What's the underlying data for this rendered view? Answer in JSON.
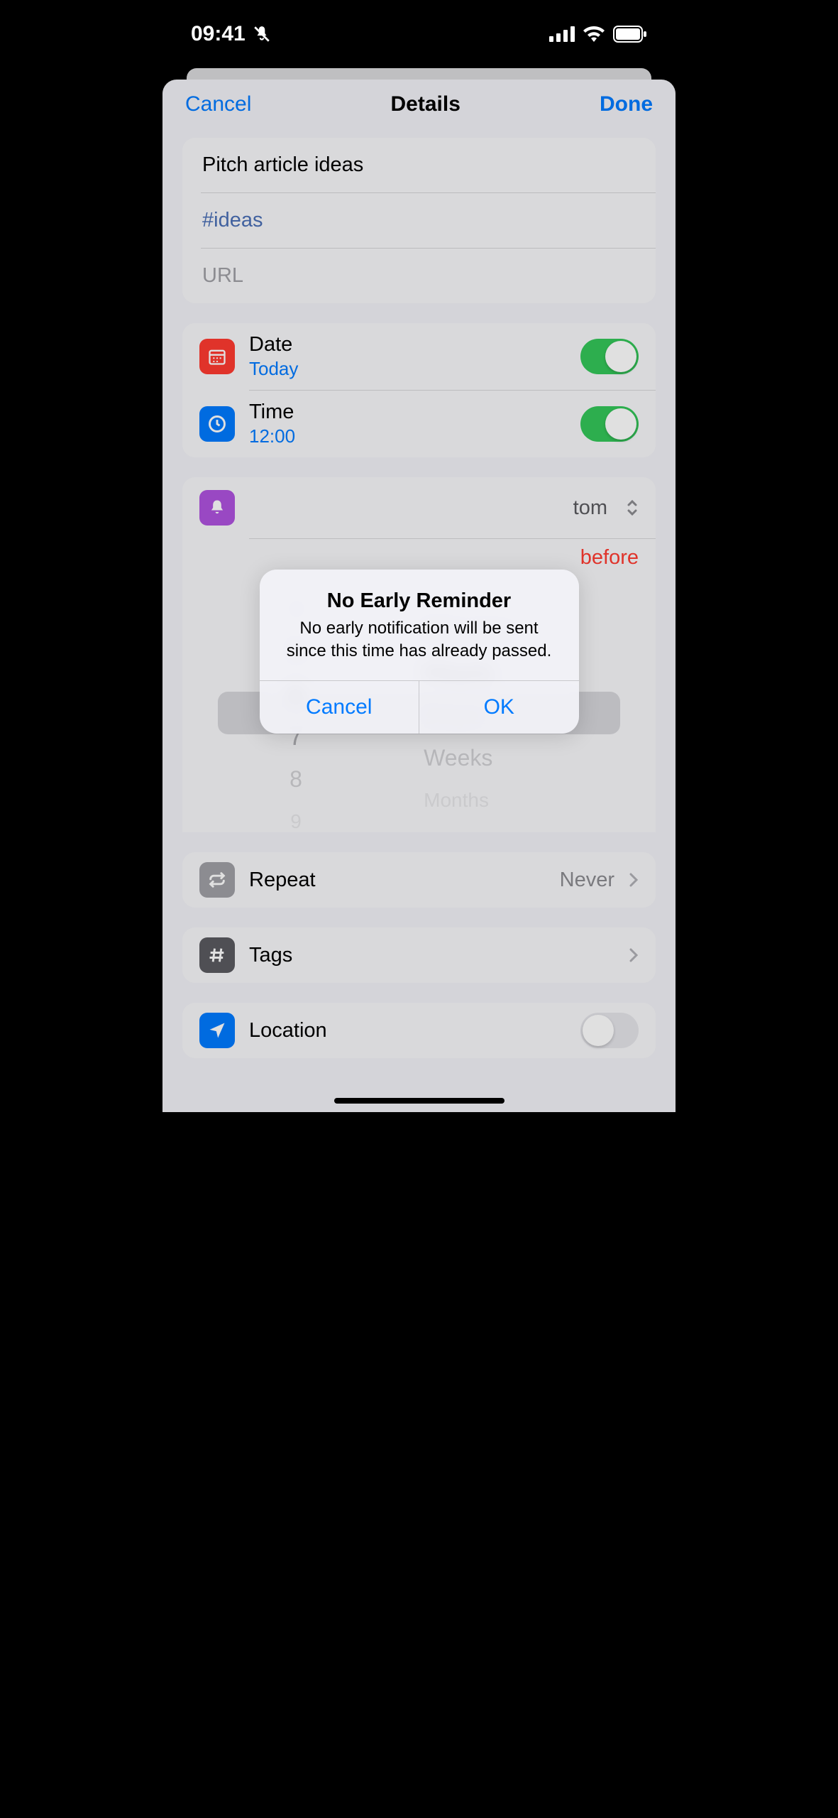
{
  "status": {
    "time": "09:41"
  },
  "header": {
    "cancel": "Cancel",
    "title": "Details",
    "done": "Done"
  },
  "reminder": {
    "title": "Pitch article ideas",
    "tag": "#ideas",
    "url_placeholder": "URL"
  },
  "date_row": {
    "label": "Date",
    "value": "Today"
  },
  "time_row": {
    "label": "Time",
    "value": "12:00"
  },
  "early_reminder": {
    "mode_fragment": "tom",
    "before_fragment": "before"
  },
  "picker": {
    "numbers": [
      "4",
      "5",
      "6",
      "7",
      "8",
      "9"
    ],
    "units": [
      "Minutes",
      "Hours",
      "Days",
      "Weeks",
      "Months"
    ]
  },
  "repeat": {
    "label": "Repeat",
    "value": "Never"
  },
  "tags": {
    "label": "Tags"
  },
  "location": {
    "label": "Location"
  },
  "alert": {
    "title": "No Early Reminder",
    "message": "No early notification will be sent since this time has already passed.",
    "cancel": "Cancel",
    "ok": "OK"
  }
}
